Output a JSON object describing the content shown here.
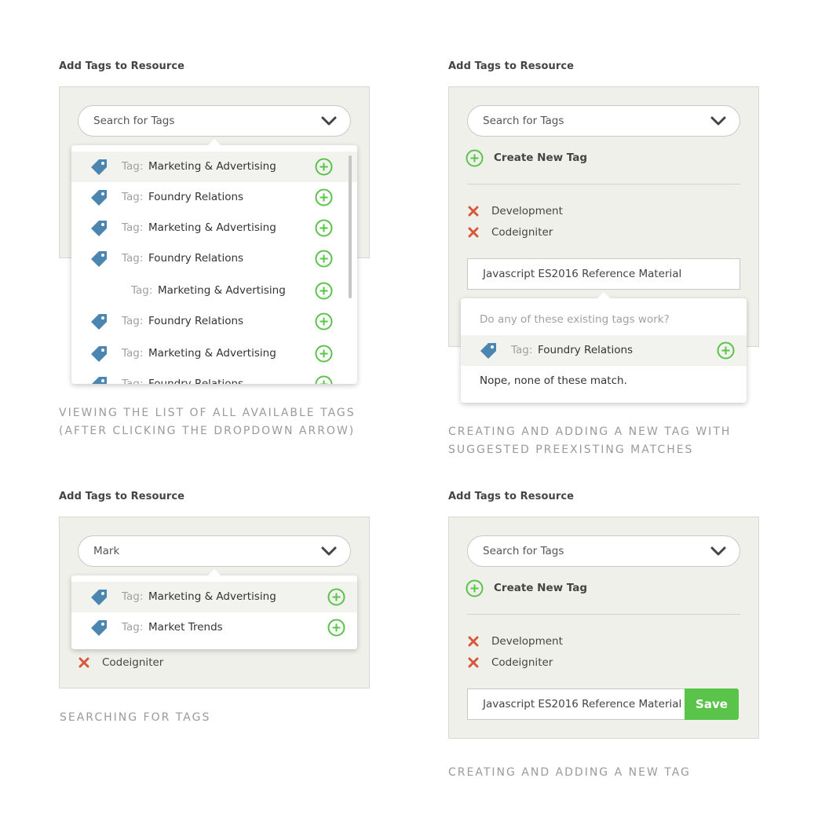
{
  "colors": {
    "accent_green": "#5ac34a",
    "remove_red": "#d9573b",
    "tag_blue": "#4a86b0",
    "panel_bg": "#f0f0eb"
  },
  "icons": {
    "tag": "tag-icon",
    "add": "plus-circle-icon",
    "remove": "x-icon",
    "chevron": "chevron-down-icon"
  },
  "panels": {
    "browse": {
      "heading": "Add Tags to Resource",
      "search_placeholder": "Search for Tags",
      "caption_line1": "VIEWING THE LIST OF ALL AVAILABLE TAGS",
      "caption_line2": "(AFTER CLICKING THE DROPDOWN ARROW)",
      "rows": [
        {
          "prefix": "Tag:",
          "name": "Marketing & Advertising"
        },
        {
          "prefix": "Tag:",
          "name": "Foundry Relations"
        },
        {
          "prefix": "Tag:",
          "name": "Marketing & Advertising"
        },
        {
          "prefix": "Tag:",
          "name": "Foundry Relations"
        },
        {
          "prefix": "Tag:",
          "name": "Marketing & Advertising"
        },
        {
          "prefix": "Tag:",
          "name": "Foundry Relations"
        },
        {
          "prefix": "Tag:",
          "name": "Marketing & Advertising"
        },
        {
          "prefix": "Tag:",
          "name": "Foundry Relations"
        }
      ]
    },
    "suggest": {
      "heading": "Add Tags to Resource",
      "search_placeholder": "Search for Tags",
      "create_label": "Create New Tag",
      "selected": [
        "Development",
        "Codeigniter"
      ],
      "new_tag_value": "Javascript ES2016 Reference Material",
      "question": "Do any of these existing tags work?",
      "match": {
        "prefix": "Tag:",
        "name": "Foundry Relations"
      },
      "nope": "Nope, none of these match.",
      "caption_line1": "CREATING AND ADDING A NEW TAG WITH",
      "caption_line2": "SUGGESTED PREEXISTING MATCHES"
    },
    "search": {
      "heading": "Add Tags to Resource",
      "search_value": "Mark",
      "rows": [
        {
          "prefix": "Tag:",
          "name": "Marketing & Advertising"
        },
        {
          "prefix": "Tag:",
          "name": "Market Trends"
        }
      ],
      "selected": [
        "Codeigniter"
      ],
      "caption": "SEARCHING FOR TAGS"
    },
    "create": {
      "heading": "Add Tags to Resource",
      "search_placeholder": "Search for Tags",
      "create_label": "Create New Tag",
      "selected": [
        "Development",
        "Codeigniter"
      ],
      "new_tag_value": "Javascript ES2016 Reference Material",
      "save_label": "Save",
      "caption": "CREATING AND ADDING A NEW TAG"
    }
  }
}
